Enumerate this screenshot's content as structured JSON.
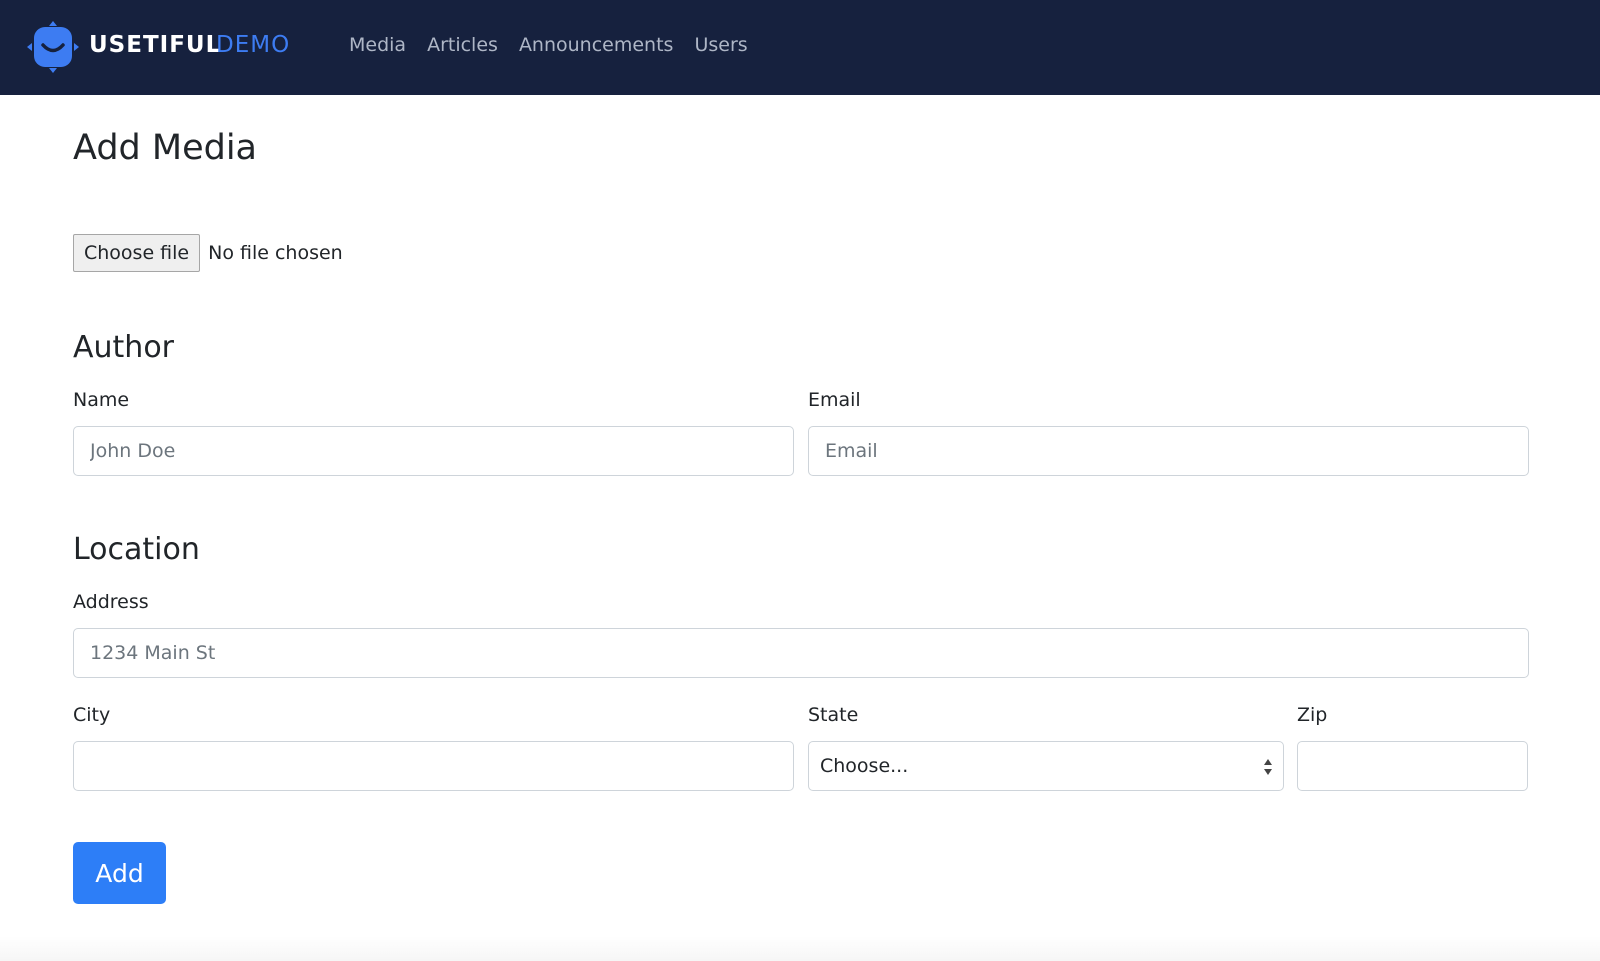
{
  "brand": {
    "name": "USETIFUL",
    "suffix": "DEMO",
    "logo_icon": "smiley-logo-icon",
    "colors": {
      "navbar": "#16213e",
      "suffix": "#3d7cf2"
    }
  },
  "nav": {
    "items": [
      {
        "label": "Media"
      },
      {
        "label": "Articles"
      },
      {
        "label": "Announcements"
      },
      {
        "label": "Users"
      }
    ]
  },
  "page": {
    "title": "Add Media"
  },
  "file": {
    "button_label": "Choose file",
    "status": "No file chosen"
  },
  "author": {
    "heading": "Author",
    "name_label": "Name",
    "name_placeholder": "John Doe",
    "email_label": "Email",
    "email_placeholder": "Email"
  },
  "location": {
    "heading": "Location",
    "address_label": "Address",
    "address_placeholder": "1234 Main St",
    "city_label": "City",
    "city_value": "",
    "state_label": "State",
    "state_selected": "Choose...",
    "zip_label": "Zip",
    "zip_value": ""
  },
  "actions": {
    "add_label": "Add",
    "add_color": "#2d7ef7"
  }
}
